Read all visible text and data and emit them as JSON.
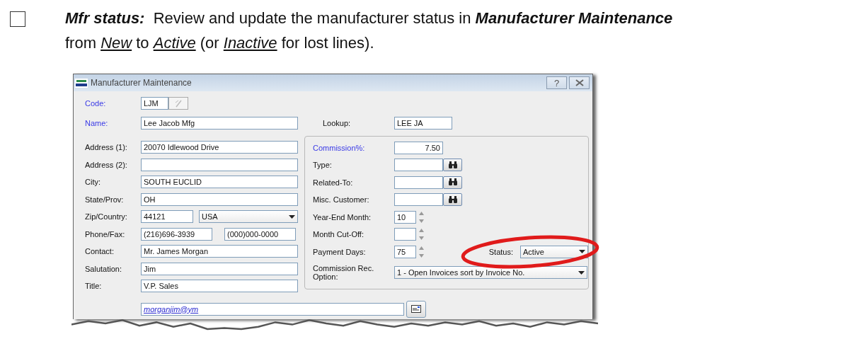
{
  "instruction": {
    "checked": false,
    "segments": [
      {
        "kind": "term",
        "text": "Mfr status:"
      },
      {
        "kind": "prose",
        "text": "  Review and update the manufacturer status in "
      },
      {
        "kind": "term",
        "text": "Manufacturer Maintenance"
      },
      {
        "kind": "prose",
        "text": " from "
      },
      {
        "kind": "value",
        "text": "New"
      },
      {
        "kind": "prose",
        "text": " to "
      },
      {
        "kind": "value",
        "text": "Active"
      },
      {
        "kind": "prose",
        "text": " (or "
      },
      {
        "kind": "value",
        "text": "Inactive"
      },
      {
        "kind": "prose",
        "text": " for lost lines)."
      }
    ]
  },
  "window": {
    "title": "Manufacturer Maintenance",
    "help_button": "?"
  },
  "header_fields": {
    "code": {
      "label": "Code:",
      "required": true,
      "value": "LJM",
      "edit_disabled": true
    },
    "name": {
      "label": "Name:",
      "required": true,
      "value": "Lee Jacob Mfg"
    },
    "lookup": {
      "label": "Lookup:",
      "required": false,
      "value": "LEE JA"
    }
  },
  "address_fields": [
    {
      "kind": "text",
      "label": "Address (1):",
      "required": false,
      "value": "20070 Idlewood Drive"
    },
    {
      "kind": "text",
      "label": "Address (2):",
      "required": false
    },
    {
      "kind": "text",
      "label": "City:",
      "required": false,
      "value": "SOUTH EUCLID"
    },
    {
      "kind": "text",
      "label": "State/Prov:",
      "required": false,
      "value": "OH"
    },
    {
      "kind": "zip-country",
      "label": "Zip/Country:",
      "required": false,
      "values": [
        "44121",
        "USA"
      ]
    },
    {
      "kind": "pair",
      "label": "Phone/Fax:",
      "required": false,
      "values": [
        "(216)696-3939",
        "(000)000-0000"
      ]
    },
    {
      "kind": "text",
      "label": "Contact:",
      "required": false,
      "value": "Mr. James Morgan"
    },
    {
      "kind": "text",
      "label": "Salutation:",
      "required": false,
      "value": "Jim"
    },
    {
      "kind": "text",
      "label": "Title:",
      "required": false,
      "value": "V.P. Sales"
    }
  ],
  "terms_fields": [
    {
      "kind": "number",
      "label": "Commission%:",
      "required": true,
      "value": "7.50"
    },
    {
      "kind": "lookup",
      "label": "Type:",
      "required": false
    },
    {
      "kind": "lookup",
      "label": "Related-To:",
      "required": false
    },
    {
      "kind": "lookup",
      "label": "Misc. Customer:",
      "required": false
    },
    {
      "kind": "spinner",
      "label": "Year-End Month:",
      "required": false,
      "value": "10"
    },
    {
      "kind": "spinner",
      "label": "Month Cut-Off:",
      "required": false
    },
    {
      "kind": "spinner-status",
      "label": "Payment Days:",
      "required": false,
      "value": "75"
    },
    {
      "kind": "select",
      "label": "Commission Rec. Option:",
      "required": false,
      "value": "1 - Open Invoices sort by Invoice No."
    }
  ],
  "status": {
    "label": "Status:",
    "value": "Active"
  },
  "email": {
    "value": "morganjim@ym"
  }
}
